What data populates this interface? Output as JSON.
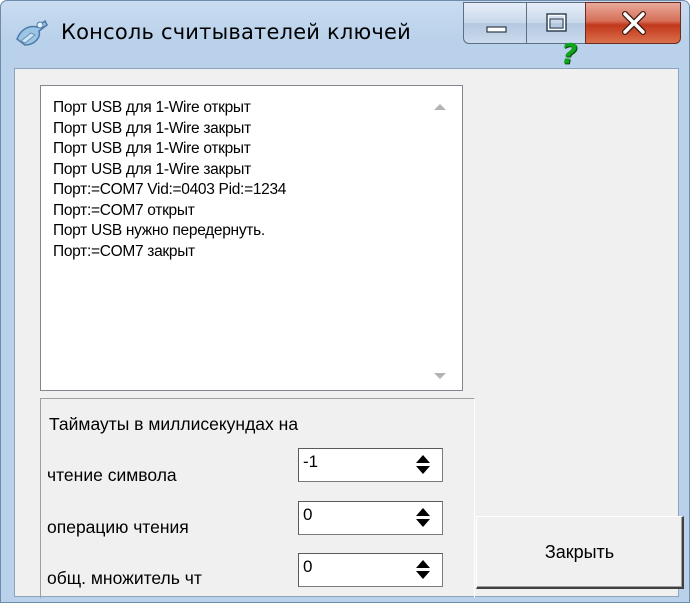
{
  "window": {
    "title": "Консоль считывателей ключей",
    "icon": "key-reader-app-icon",
    "controls": [
      "minimize-icon",
      "maximize-icon",
      "close-icon"
    ]
  },
  "log": {
    "lines": [
      "Порт USB для 1-Wire открыт",
      "Порт USB для 1-Wire закрыт",
      "Порт USB для 1-Wire открыт",
      "Порт USB для 1-Wire закрыт",
      "Порт:=COM7 Vid:=0403 Pid:=1234",
      "Порт:=COM7 открыт",
      "Порт USB нужно передернуть.",
      "Порт:=COM7 закрыт"
    ]
  },
  "help": {
    "symbol": "?",
    "color": "#12a31c"
  },
  "timeouts": {
    "heading": "Таймауты в миллисекундах на",
    "rows": [
      {
        "label": "чтение символа",
        "value": "-1"
      },
      {
        "label": "операцию чтения",
        "value": "0"
      },
      {
        "label": "общ. множитель чт",
        "value": "0"
      }
    ]
  },
  "buttons": {
    "close_label": "Закрыть"
  },
  "colors": {
    "close_button_red": "#c2381b",
    "frame_blue": "#b9d1ea"
  }
}
